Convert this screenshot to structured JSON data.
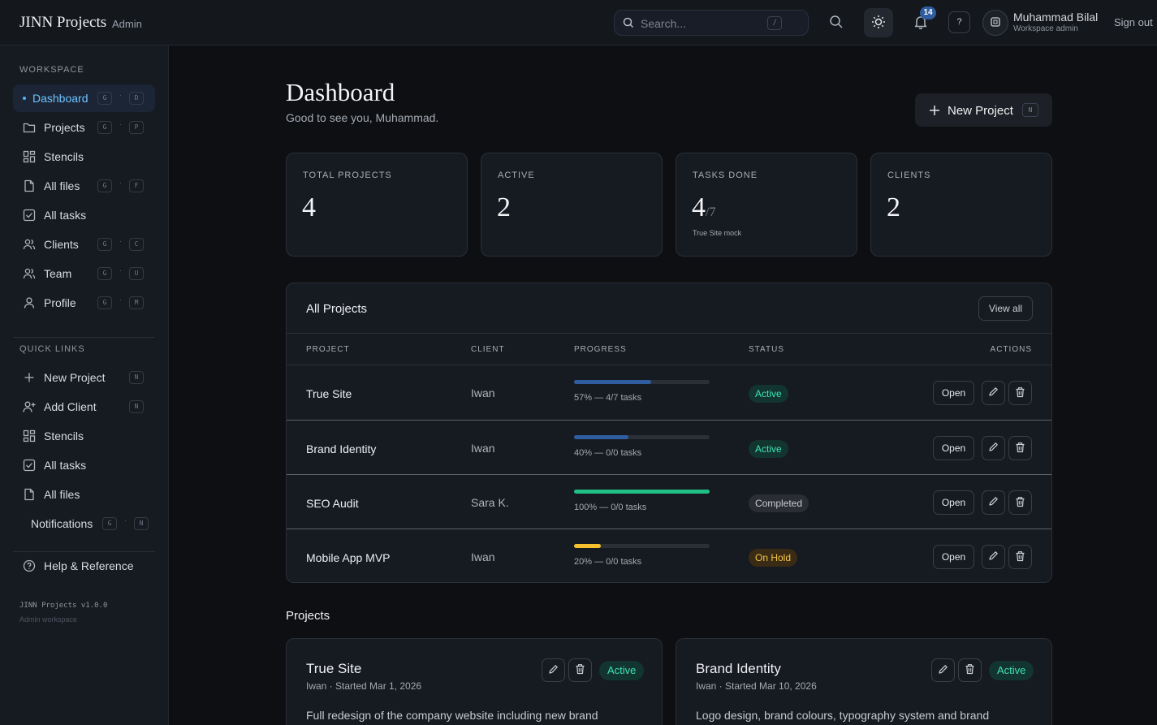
{
  "topbar": {
    "brand": "JINN Projects",
    "role": "Admin",
    "search_placeholder": "Search...",
    "search_kbd": "/",
    "notification_count": "14",
    "help_label": "?",
    "user_name": "Muhammad Bilal",
    "user_role": "Workspace admin",
    "signout": "Sign out"
  },
  "sidebar": {
    "workspace_heading": "WORKSPACE",
    "workspace_items": [
      {
        "label": "Dashboard",
        "icon": "dot-icon",
        "keys": [
          "G",
          "D"
        ]
      },
      {
        "label": "Projects",
        "icon": "folder-icon",
        "keys": [
          "G",
          "P"
        ]
      },
      {
        "label": "Stencils",
        "icon": "grid-icon",
        "keys": []
      },
      {
        "label": "All files",
        "icon": "file-icon",
        "keys": [
          "G",
          "F"
        ]
      },
      {
        "label": "All tasks",
        "icon": "checkbox-icon",
        "keys": []
      },
      {
        "label": "Clients",
        "icon": "users-icon",
        "keys": [
          "G",
          "C"
        ]
      },
      {
        "label": "Team",
        "icon": "users-icon",
        "keys": [
          "G",
          "U"
        ]
      },
      {
        "label": "Profile",
        "icon": "user-icon",
        "keys": [
          "G",
          "M"
        ]
      }
    ],
    "quick_heading": "QUICK LINKS",
    "quick_items": [
      {
        "label": "New Project",
        "icon": "plus-icon",
        "keys": [
          "N"
        ]
      },
      {
        "label": "Add Client",
        "icon": "user-plus-icon",
        "keys": [
          "N"
        ]
      },
      {
        "label": "Stencils",
        "icon": "grid-icon",
        "keys": []
      },
      {
        "label": "All tasks",
        "icon": "checkbox-icon",
        "keys": []
      },
      {
        "label": "All files",
        "icon": "file-icon",
        "keys": []
      },
      {
        "label": "Notifications",
        "icon": "",
        "keys": [
          "G",
          "N"
        ]
      }
    ],
    "help": "Help & Reference",
    "version": "JINN Projects v1.0.0",
    "workspace_note": "Admin workspace"
  },
  "header": {
    "title": "Dashboard",
    "subtitle": "Good to see you, Muhammad.",
    "new_project_label": "New Project",
    "new_project_kbd": "N"
  },
  "stats": [
    {
      "label": "TOTAL PROJECTS",
      "value": "4",
      "total": "",
      "note": ""
    },
    {
      "label": "ACTIVE",
      "value": "2",
      "total": "",
      "note": ""
    },
    {
      "label": "TASKS DONE",
      "value": "4",
      "total": "/7",
      "note": "True Site mock"
    },
    {
      "label": "CLIENTS",
      "value": "2",
      "total": "",
      "note": ""
    }
  ],
  "projects_table": {
    "title": "All Projects",
    "view_all": "View all",
    "columns": [
      "PROJECT",
      "CLIENT",
      "PROGRESS",
      "STATUS",
      "ACTIONS"
    ],
    "open_label": "Open",
    "rows": [
      {
        "name": "True Site",
        "client": "Iwan",
        "progress": 57,
        "progress_text": "57% — 4/7 tasks",
        "status": "Active",
        "bar_color": "#2f5d9f"
      },
      {
        "name": "Brand Identity",
        "client": "Iwan",
        "progress": 40,
        "progress_text": "40% — 0/0 tasks",
        "status": "Active",
        "bar_color": "#2f5d9f"
      },
      {
        "name": "SEO Audit",
        "client": "Sara K.",
        "progress": 100,
        "progress_text": "100% — 0/0 tasks",
        "status": "Completed",
        "bar_color": "#1fbf86"
      },
      {
        "name": "Mobile App MVP",
        "client": "Iwan",
        "progress": 20,
        "progress_text": "20% — 0/0 tasks",
        "status": "On Hold",
        "bar_color": "#f5c12e"
      }
    ]
  },
  "projects_section": {
    "title": "Projects",
    "cards": [
      {
        "name": "True Site",
        "meta": "Iwan · Started Mar 1, 2026",
        "status": "Active",
        "description": "Full redesign of the company website including new brand"
      },
      {
        "name": "Brand Identity",
        "meta": "Iwan · Started Mar 10, 2026",
        "status": "Active",
        "description": "Logo design, brand colours, typography system and brand"
      }
    ]
  },
  "colors": {
    "accent": "#6ec3ff",
    "active_status": "#3ee3b3",
    "hold_status": "#f5c44a",
    "badge": "#2f5d9f"
  }
}
